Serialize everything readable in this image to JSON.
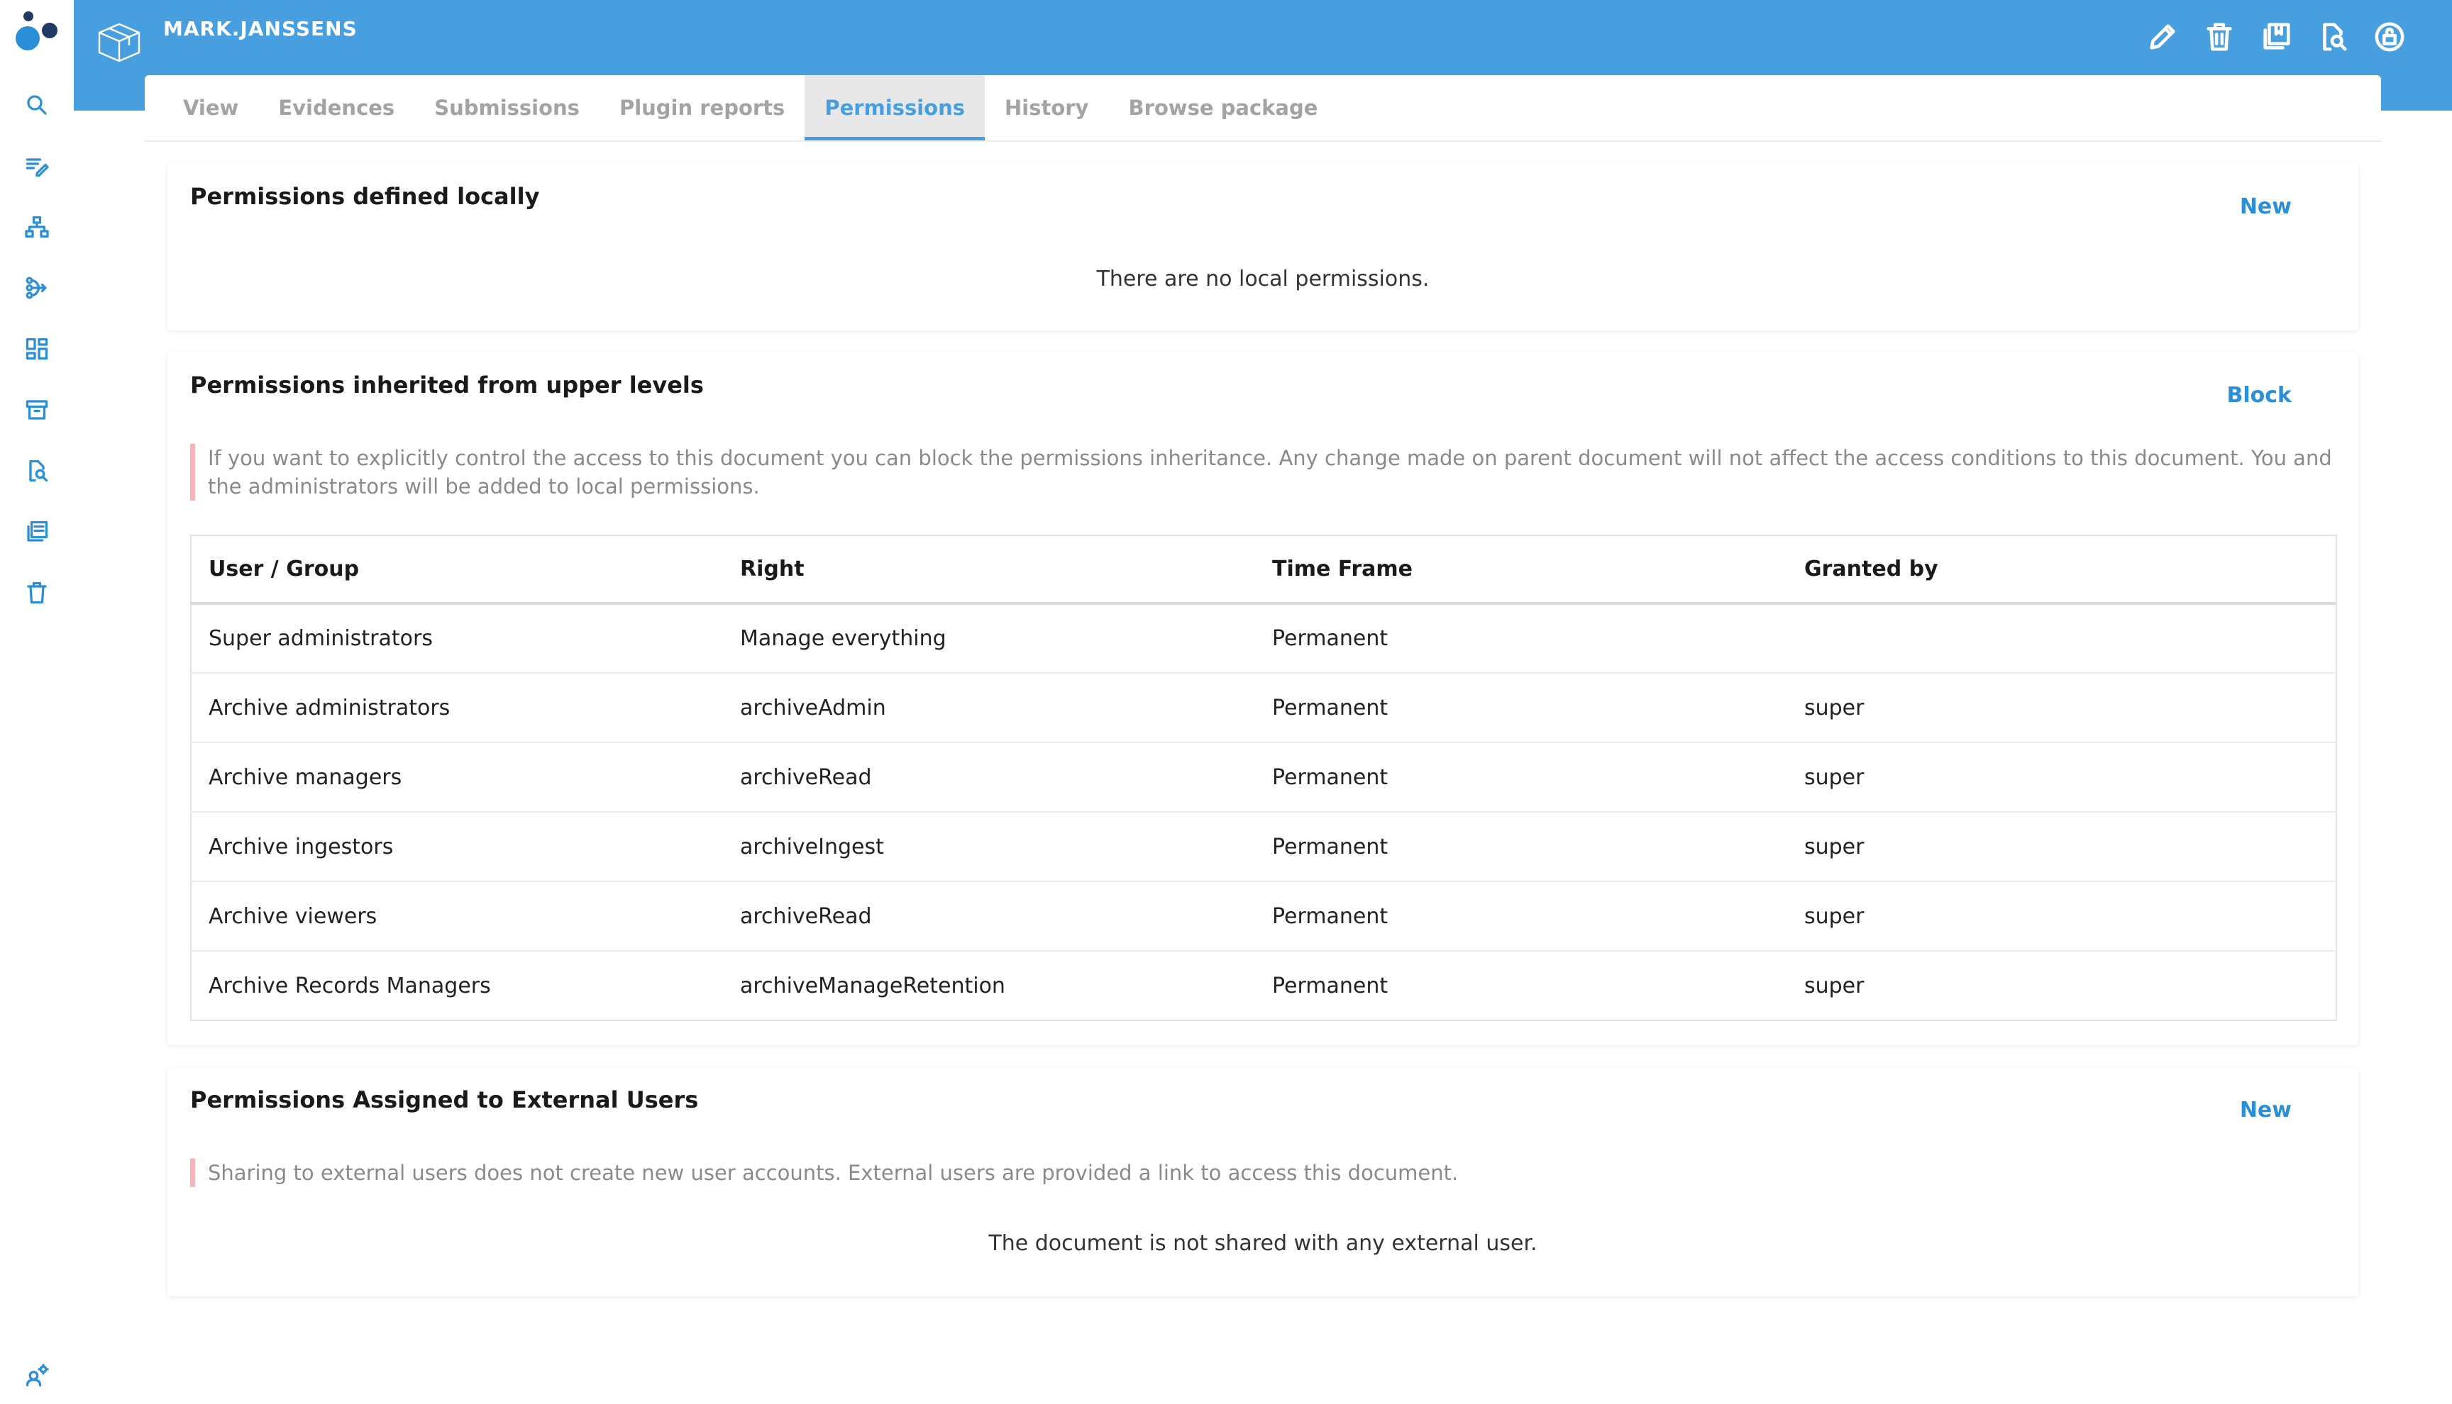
{
  "header": {
    "title": "MARK.JANSSENS",
    "actions": [
      {
        "icon": "pencil-icon",
        "name": "edit-button"
      },
      {
        "icon": "trash-icon",
        "name": "delete-button"
      },
      {
        "icon": "copy-icon",
        "name": "copy-button"
      },
      {
        "icon": "move-icon",
        "name": "move-button"
      },
      {
        "icon": "unlock-icon",
        "name": "unlock-button"
      }
    ]
  },
  "sidebar": {
    "items": [
      {
        "icon": "search-icon"
      },
      {
        "icon": "edit-list-icon"
      },
      {
        "icon": "hierarchy-icon"
      },
      {
        "icon": "workflow-icon"
      },
      {
        "icon": "dashboard-icon"
      },
      {
        "icon": "archive-icon"
      },
      {
        "icon": "search-document-icon"
      },
      {
        "icon": "clipboard-icon"
      },
      {
        "icon": "trash-icon"
      }
    ],
    "bottom_icon": "user-settings-icon"
  },
  "tabs": [
    {
      "label": "View",
      "active": false
    },
    {
      "label": "Evidences",
      "active": false
    },
    {
      "label": "Submissions",
      "active": false
    },
    {
      "label": "Plugin reports",
      "active": false
    },
    {
      "label": "Permissions",
      "active": true
    },
    {
      "label": "History",
      "active": false
    },
    {
      "label": "Browse package",
      "active": false
    }
  ],
  "local": {
    "title": "Permissions defined locally",
    "action": "New",
    "empty": "There are no local permissions."
  },
  "inherited": {
    "title": "Permissions inherited from upper levels",
    "action": "Block",
    "note": "If you want to explicitly control the access to this document you can block the permissions inheritance. Any change made on parent document will not affect the access conditions to this document. You and the administrators will be added to local permissions.",
    "columns": [
      "User / Group",
      "Right",
      "Time Frame",
      "Granted by"
    ],
    "rows": [
      [
        "Super administrators",
        "Manage everything",
        "Permanent",
        ""
      ],
      [
        "Archive administrators",
        "archiveAdmin",
        "Permanent",
        "super"
      ],
      [
        "Archive managers",
        "archiveRead",
        "Permanent",
        "super"
      ],
      [
        "Archive ingestors",
        "archiveIngest",
        "Permanent",
        "super"
      ],
      [
        "Archive viewers",
        "archiveRead",
        "Permanent",
        "super"
      ],
      [
        "Archive Records Managers",
        "archiveManageRetention",
        "Permanent",
        "super"
      ]
    ]
  },
  "external": {
    "title": "Permissions Assigned to External Users",
    "action": "New",
    "note": "Sharing to external users does not create new user accounts. External users are provided a link to access this document.",
    "empty": "The document is not shared with any external user."
  },
  "colors": {
    "brand": "#479fdf",
    "accent": "#2b8fd8",
    "note_border": "#f2b5bc"
  }
}
